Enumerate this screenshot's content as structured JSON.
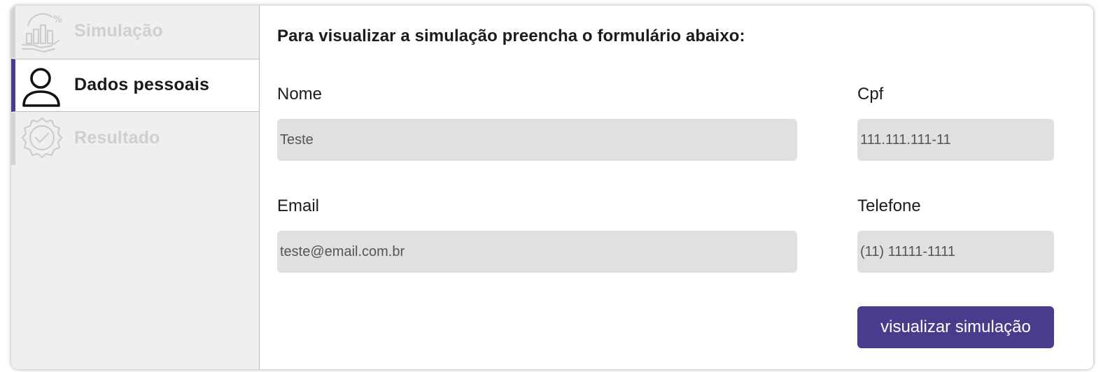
{
  "sidebar": {
    "steps": [
      {
        "label": "Simulação",
        "icon": "chart-hand-icon",
        "state": "inactive"
      },
      {
        "label": "Dados pessoais",
        "icon": "user-icon",
        "state": "active"
      },
      {
        "label": "Resultado",
        "icon": "badge-check-icon",
        "state": "inactive"
      }
    ]
  },
  "form": {
    "heading": "Para visualizar a simulação preencha o formulário abaixo:",
    "fields": {
      "nome": {
        "label": "Nome",
        "value": "Teste"
      },
      "cpf": {
        "label": "Cpf",
        "value": "111.111.111-11"
      },
      "email": {
        "label": "Email",
        "value": "teste@email.com.br"
      },
      "telefone": {
        "label": "Telefone",
        "value": "(11) 11111-1111"
      }
    },
    "submit_label": "visualizar simulação"
  },
  "colors": {
    "accent": "#4a3b8c",
    "sidebar_bg": "#efefef",
    "input_bg": "#e0e0e0",
    "inactive_text": "#cfcfcf"
  }
}
